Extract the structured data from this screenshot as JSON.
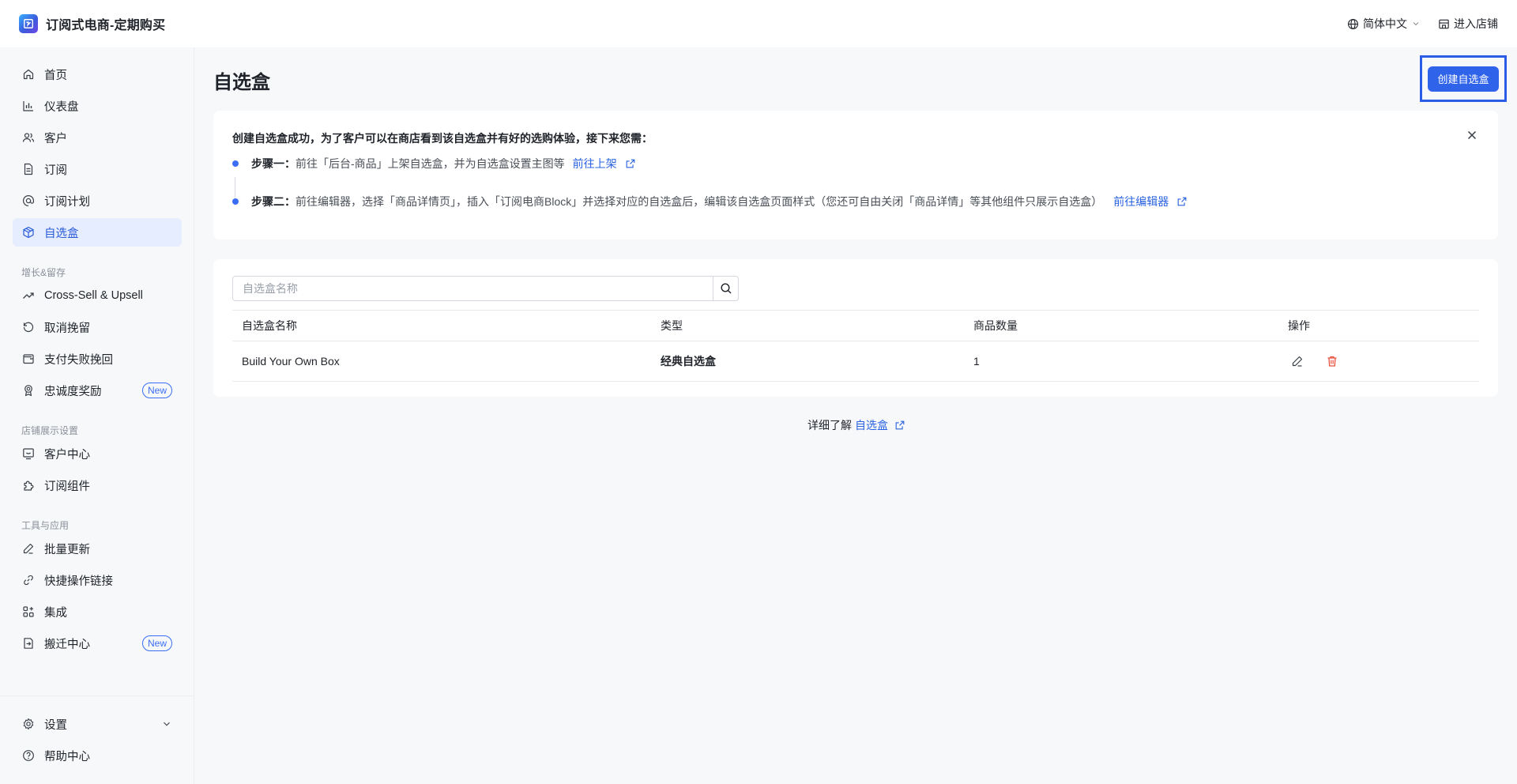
{
  "header": {
    "app_title": "订阅式电商-定期购买",
    "language": "简体中文",
    "enter_store": "进入店铺"
  },
  "sidebar": {
    "items": [
      {
        "label": "首页",
        "icon": "home-icon"
      },
      {
        "label": "仪表盘",
        "icon": "bar-chart-icon"
      },
      {
        "label": "客户",
        "icon": "users-icon"
      },
      {
        "label": "订阅",
        "icon": "document-icon"
      },
      {
        "label": "订阅计划",
        "icon": "at-sign-icon"
      },
      {
        "label": "自选盒",
        "icon": "box-icon",
        "active": true
      }
    ],
    "group_growth": "增长&留存",
    "growth_items": [
      {
        "label": "Cross-Sell & Upsell",
        "icon": "trend-up-icon"
      },
      {
        "label": "取消挽留",
        "icon": "refresh-icon"
      },
      {
        "label": "支付失败挽回",
        "icon": "wallet-icon"
      },
      {
        "label": "忠诚度奖励",
        "icon": "award-icon",
        "badge": "New"
      }
    ],
    "group_store": "店铺展示设置",
    "store_items": [
      {
        "label": "客户中心",
        "icon": "smile-monitor-icon"
      },
      {
        "label": "订阅组件",
        "icon": "puzzle-icon"
      }
    ],
    "group_tools": "工具与应用",
    "tools_items": [
      {
        "label": "批量更新",
        "icon": "pen-icon"
      },
      {
        "label": "快捷操作链接",
        "icon": "link-icon"
      },
      {
        "label": "集成",
        "icon": "grid-icon"
      },
      {
        "label": "搬迁中心",
        "icon": "migrate-icon",
        "badge": "New"
      }
    ],
    "bottom_items": [
      {
        "label": "设置",
        "icon": "gear-icon"
      },
      {
        "label": "帮助中心",
        "icon": "help-icon"
      }
    ]
  },
  "main": {
    "title": "自选盒",
    "create_button": "创建自选盒",
    "notice": {
      "title": "创建自选盒成功，为了客户可以在商店看到该自选盒并有好的选购体验，接下来您需：",
      "step1_label": "步骤一：",
      "step1_text": "前往「后台-商品」上架自选盒，并为自选盒设置主图等",
      "step1_link": "前往上架",
      "step2_label": "步骤二：",
      "step2_text": "前往编辑器，选择「商品详情页」，插入「订阅电商Block」并选择对应的自选盒后，编辑该自选盒页面样式（您还可自由关闭「商品详情」等其他组件只展示自选盒）",
      "step2_link": "前往编辑器"
    },
    "search": {
      "placeholder": "自选盒名称",
      "value": ""
    },
    "table": {
      "columns": [
        "自选盒名称",
        "类型",
        "商品数量",
        "操作"
      ],
      "rows": [
        {
          "name": "Build Your Own Box",
          "type": "经典自选盒",
          "count": "1"
        }
      ]
    },
    "learn_more_prefix": "详细了解",
    "learn_more_link": "自选盒"
  },
  "colors": {
    "accent": "#2f63ea",
    "active_bg": "#e5edff",
    "delete": "#e8503a"
  }
}
